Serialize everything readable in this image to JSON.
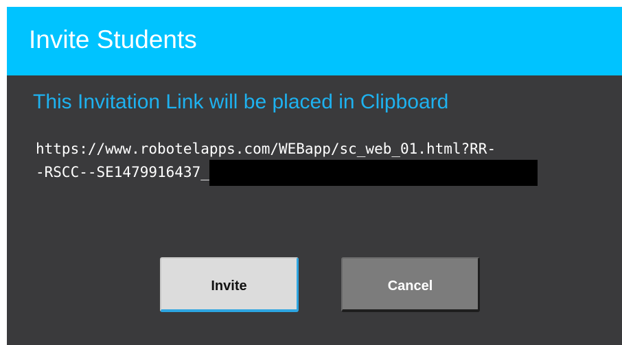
{
  "dialog": {
    "title": "Invite Students",
    "subtitle": "This Invitation Link will be placed in Clipboard",
    "link": {
      "line1": "https://www.robotelapps.com/WEBapp/sc_web_01.html?RR-",
      "line2": "-RSCC--SE1479916437_"
    },
    "buttons": {
      "invite": "Invite",
      "cancel": "Cancel"
    }
  },
  "colors": {
    "header": "#00c3ff",
    "body": "#3a3a3c",
    "subtitle": "#1eb2f0",
    "invite_button": "#dcdcdc",
    "cancel_button": "#7c7c7c"
  }
}
